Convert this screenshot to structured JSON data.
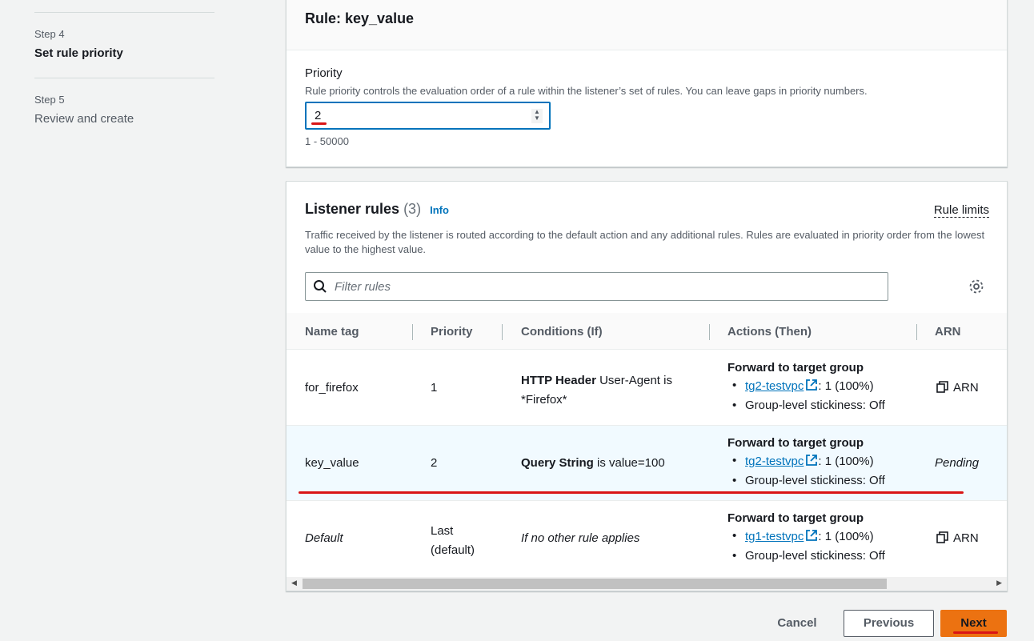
{
  "steps": [
    {
      "num": "Step 4",
      "title": "Set rule priority",
      "active": true
    },
    {
      "num": "Step 5",
      "title": "Review and create",
      "active": false
    }
  ],
  "rule_panel": {
    "title": "Rule: key_value",
    "priority_label": "Priority",
    "priority_desc": "Rule priority controls the evaluation order of a rule within the listener’s set of rules. You can leave gaps in priority numbers.",
    "priority_value": "2",
    "priority_hint": "1 - 50000"
  },
  "listener_rules": {
    "title": "Listener rules",
    "count": "(3)",
    "info": "Info",
    "rule_limits": "Rule limits",
    "description": "Traffic received by the listener is routed according to the default action and any additional rules. Rules are evaluated in priority order from the lowest value to the highest value.",
    "filter_placeholder": "Filter rules",
    "columns": [
      "Name tag",
      "Priority",
      "Conditions (If)",
      "Actions (Then)",
      "ARN"
    ],
    "rows": [
      {
        "name": "for_firefox",
        "priority": "1",
        "cond_bold": "HTTP Header",
        "cond_rest": " User-Agent is",
        "cond_line2": "*Firefox*",
        "action_title": "Forward to target group",
        "tg": "tg2-testvpc",
        "tg_weight": ": 1 (100%)",
        "stickiness": "Group-level stickiness: Off",
        "arn": "ARN"
      },
      {
        "name": "key_value",
        "priority": "2",
        "cond_bold": "Query String",
        "cond_rest": " is value=100",
        "action_title": "Forward to target group",
        "tg": "tg2-testvpc",
        "tg_weight": ": 1 (100%)",
        "stickiness": "Group-level stickiness: Off",
        "arn": "Pending"
      },
      {
        "name": "Default",
        "priority_line1": "Last",
        "priority_line2": "(default)",
        "condition": "If no other rule applies",
        "action_title": "Forward to target group",
        "tg": "tg1-testvpc",
        "tg_weight": ": 1 (100%)",
        "stickiness": "Group-level stickiness: Off",
        "arn": "ARN"
      }
    ]
  },
  "footer": {
    "cancel": "Cancel",
    "previous": "Previous",
    "next": "Next"
  },
  "colors": {
    "link": "#0073bb",
    "primary": "#ec7211",
    "annotation_red": "#d91515",
    "selected_row": "#f1faff"
  }
}
